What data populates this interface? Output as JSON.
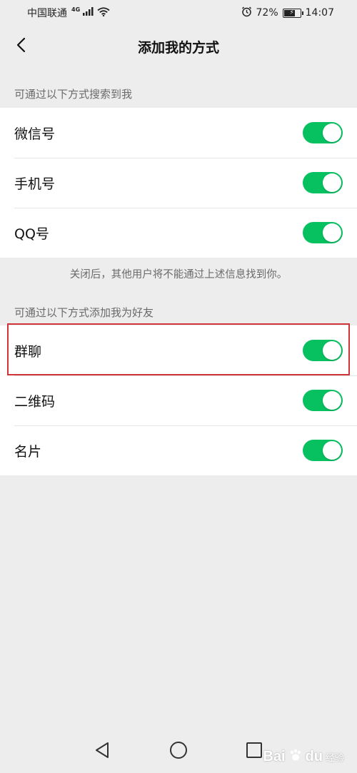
{
  "status_bar": {
    "carrier": "中国联通",
    "network_type": "4G",
    "battery_percent": "72%",
    "time": "14:07",
    "icons": [
      "signal-icon",
      "wifi-icon",
      "alarm-icon",
      "battery-charging-icon"
    ]
  },
  "nav": {
    "title": "添加我的方式",
    "back_icon": "chevron-left-icon"
  },
  "search_section": {
    "label": "可通过以下方式搜索到我",
    "items": [
      {
        "label": "微信号",
        "enabled": true
      },
      {
        "label": "手机号",
        "enabled": true
      },
      {
        "label": "QQ号",
        "enabled": true
      }
    ],
    "hint": "关闭后，其他用户将不能通过上述信息找到你。"
  },
  "add_section": {
    "label": "可通过以下方式添加我为好友",
    "items": [
      {
        "label": "群聊",
        "enabled": true
      },
      {
        "label": "二维码",
        "enabled": true
      },
      {
        "label": "名片",
        "enabled": true
      }
    ]
  },
  "system_nav": {
    "icons": [
      "nav-back-triangle-icon",
      "nav-home-circle-icon",
      "nav-recents-square-icon"
    ]
  },
  "watermark": {
    "text": "Bai",
    "text2": "du",
    "sub": "经验"
  },
  "colors": {
    "toggle_on": "#07c160",
    "highlight": "#d0343b",
    "background": "#ededed"
  }
}
